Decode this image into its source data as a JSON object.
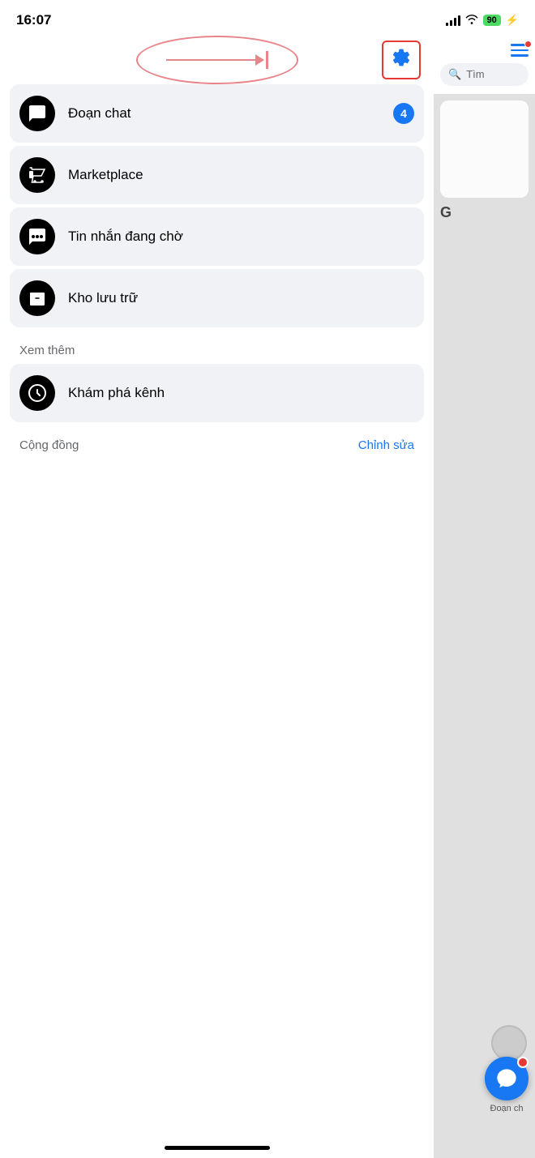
{
  "statusBar": {
    "time": "16:07",
    "battery": "90",
    "batteryIcon": "battery-icon",
    "signalIcon": "signal-icon",
    "wifiIcon": "wifi-icon",
    "notifIcon": "notification-icon"
  },
  "header": {
    "gearLabel": "⚙",
    "arrowAnnotation": "→|"
  },
  "menu": {
    "items": [
      {
        "id": "doan-chat",
        "label": "Đoạn chat",
        "badge": "4",
        "icon": "chat-bubble-icon"
      },
      {
        "id": "marketplace",
        "label": "Marketplace",
        "badge": "",
        "icon": "marketplace-icon"
      },
      {
        "id": "tin-nhan-cho",
        "label": "Tin nhắn đang chờ",
        "badge": "",
        "icon": "pending-message-icon"
      },
      {
        "id": "kho-luu-tru",
        "label": "Kho lưu trữ",
        "badge": "",
        "icon": "archive-icon"
      }
    ],
    "seeMoreLabel": "Xem thêm",
    "moreItems": [
      {
        "id": "kham-pha-kenh",
        "label": "Khám phá kênh",
        "icon": "explore-channel-icon"
      }
    ],
    "communitySection": {
      "label": "Cộng đồng",
      "actionLabel": "Chỉnh sửa"
    }
  },
  "rightPanel": {
    "searchPlaceholder": "Tìm",
    "letterG": "G",
    "fabLabel": "Đoạn ch"
  }
}
